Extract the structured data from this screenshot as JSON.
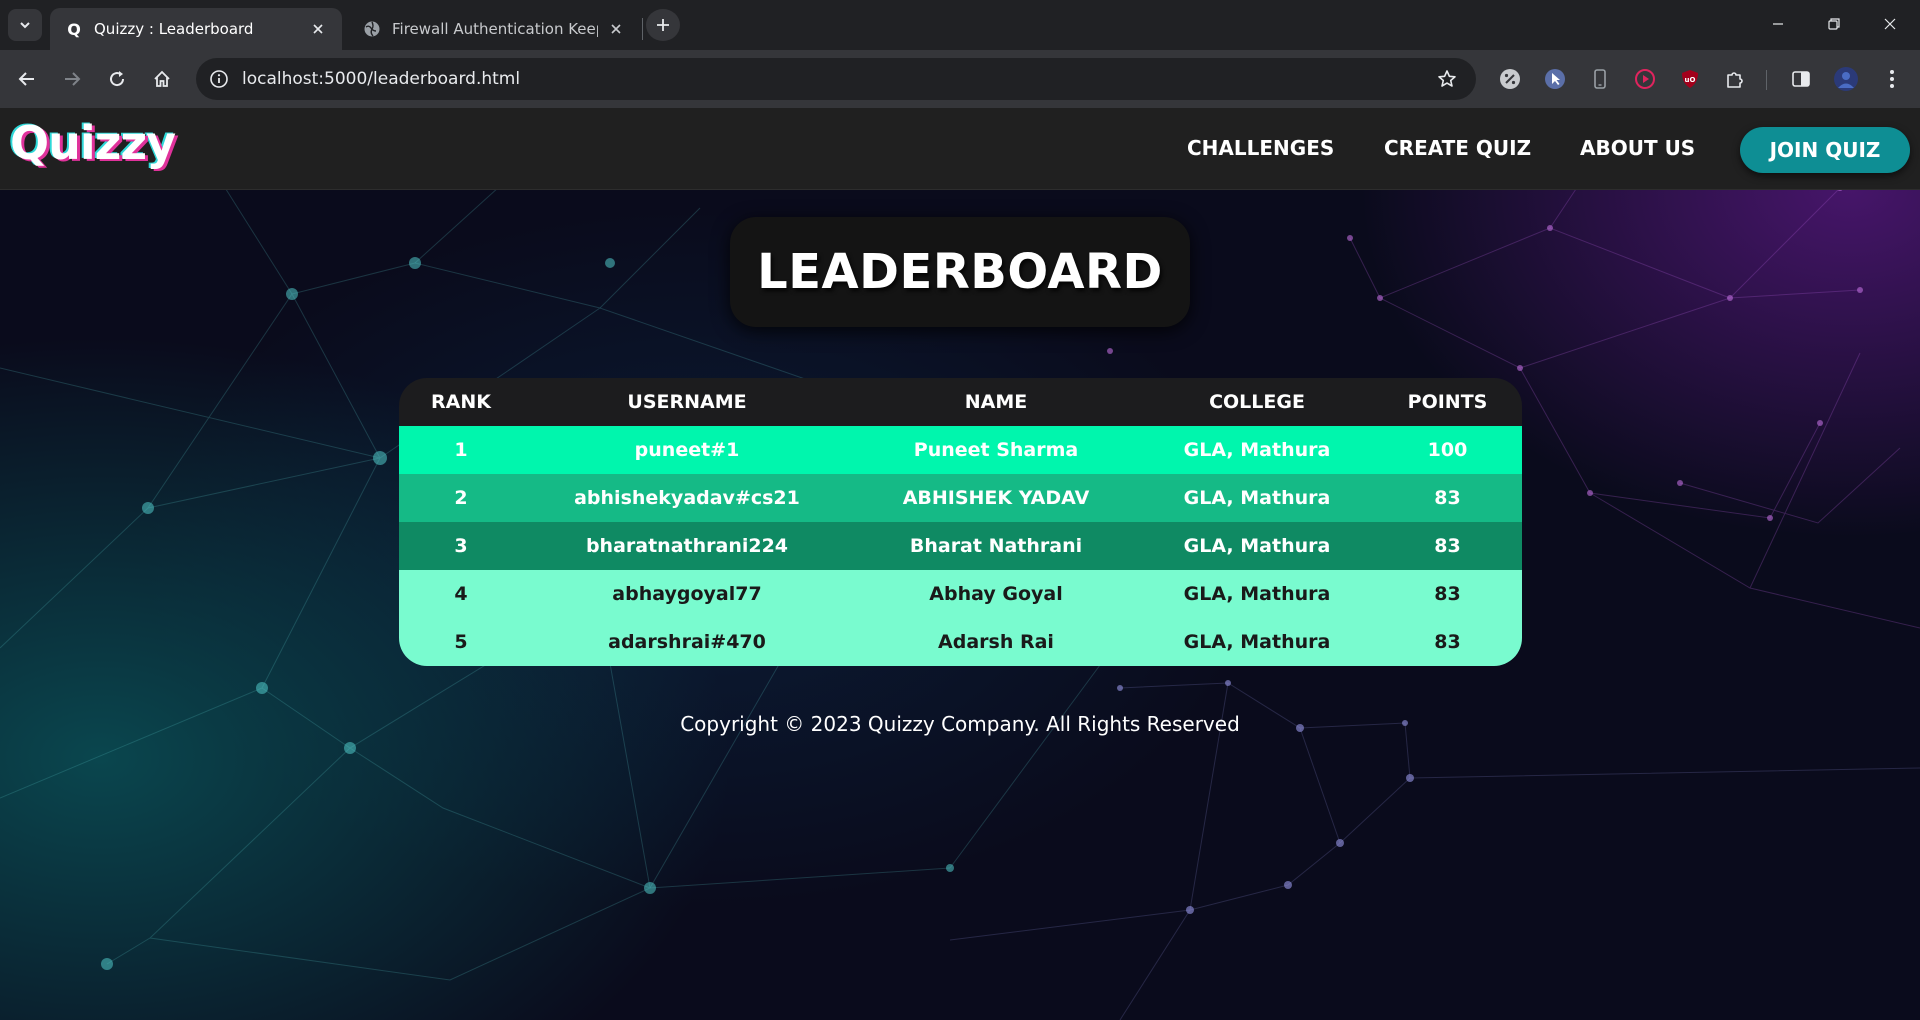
{
  "browser": {
    "tabs": [
      {
        "title": "Quizzy : Leaderboard",
        "favicon": "Q",
        "active": true
      },
      {
        "title": "Firewall Authentication Keepalive",
        "favicon": "globe-icon",
        "active": false
      }
    ],
    "url": "localhost:5000/leaderboard.html"
  },
  "site": {
    "logo": "Quizzy",
    "nav": [
      "CHALLENGES",
      "CREATE QUIZ",
      "ABOUT US"
    ],
    "cta": "JOIN QUIZ"
  },
  "leaderboard": {
    "title": "LEADERBOARD",
    "columns": [
      "RANK",
      "USERNAME",
      "NAME",
      "COLLEGE",
      "POINTS"
    ],
    "rows": [
      {
        "rank": "1",
        "username": "puneet#1",
        "name": "Puneet Sharma",
        "college": "GLA, Mathura",
        "points": "100",
        "bg": "#00f6ad",
        "fg": "#ffffff"
      },
      {
        "rank": "2",
        "username": "abhishekyadav#cs21",
        "name": "ABHISHEK YADAV",
        "college": "GLA, Mathura",
        "points": "83",
        "bg": "#15ba86",
        "fg": "#ffffff"
      },
      {
        "rank": "3",
        "username": "bharatnathrani224",
        "name": "Bharat Nathrani",
        "college": "GLA, Mathura",
        "points": "83",
        "bg": "#0f8a63",
        "fg": "#ffffff"
      },
      {
        "rank": "4",
        "username": "abhaygoyal77",
        "name": "Abhay Goyal",
        "college": "GLA, Mathura",
        "points": "83",
        "bg": "#79fbcf",
        "fg": "#1a1a1a"
      },
      {
        "rank": "5",
        "username": "adarshrai#470",
        "name": "Adarsh Rai",
        "college": "GLA, Mathura",
        "points": "83",
        "bg": "#79fbcf",
        "fg": "#1a1a1a"
      }
    ]
  },
  "footer": {
    "copyright": "Copyright © 2023 Quizzy Company. All Rights Reserved"
  },
  "colors": {
    "accent": "#0e8e94",
    "header_bg": "#202020"
  }
}
